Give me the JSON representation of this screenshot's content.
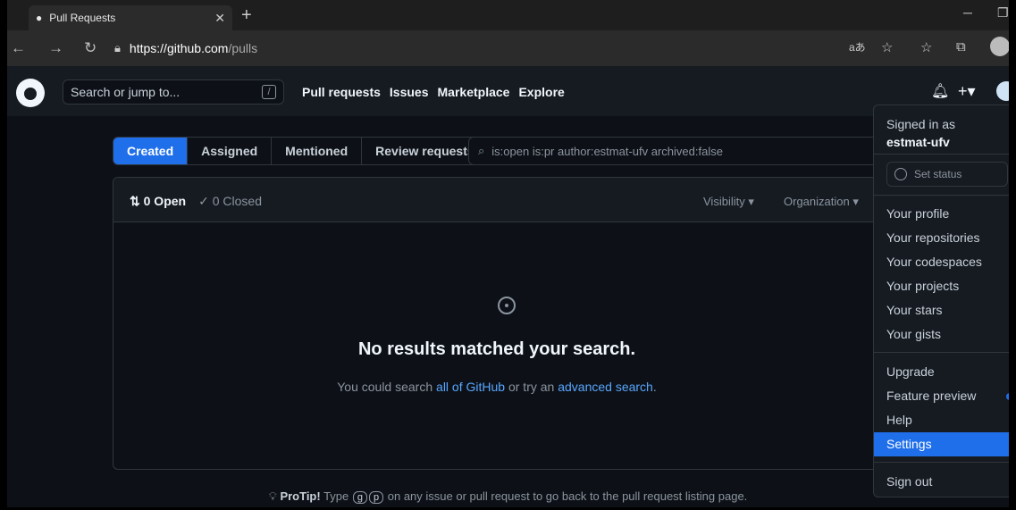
{
  "browser": {
    "tab_title": "Pull Requests",
    "url_host": "https://github.com",
    "url_path": "/pulls"
  },
  "header": {
    "search_placeholder": "Search or jump to...",
    "search_shortcut": "/",
    "nav": [
      "Pull requests",
      "Issues",
      "Marketplace",
      "Explore"
    ]
  },
  "subnav": {
    "items": [
      "Created",
      "Assigned",
      "Mentioned",
      "Review requests"
    ],
    "active": "Created"
  },
  "filter_query": "is:open is:pr author:estmat-ufv archived:false",
  "box": {
    "open_label": "0 Open",
    "closed_label": "0 Closed",
    "visibility": "Visibility",
    "organization": "Organization"
  },
  "empty": {
    "title": "No results matched your search.",
    "sub_before": "You could search ",
    "sub_link1": "all of GitHub",
    "sub_middle": " or try an ",
    "sub_link2": "advanced search",
    "sub_after": "."
  },
  "protip": {
    "label": "ProTip!",
    "before": " Type ",
    "key1": "g",
    "key2": "p",
    "after": " on any issue or pull request to go back to the pull request listing page."
  },
  "menu": {
    "signed_in_as": "Signed in as",
    "username": "estmat-ufv",
    "set_status": "Set status",
    "group1": [
      "Your profile",
      "Your repositories",
      "Your codespaces",
      "Your projects",
      "Your stars",
      "Your gists"
    ],
    "group2": [
      "Upgrade",
      "Feature preview",
      "Help",
      "Settings"
    ],
    "sign_out": "Sign out",
    "active_item": "Settings"
  },
  "colors": {
    "accent": "#1f6feb",
    "link": "#58a6ff",
    "bg": "#0d1117",
    "header_bg": "#161b22"
  }
}
